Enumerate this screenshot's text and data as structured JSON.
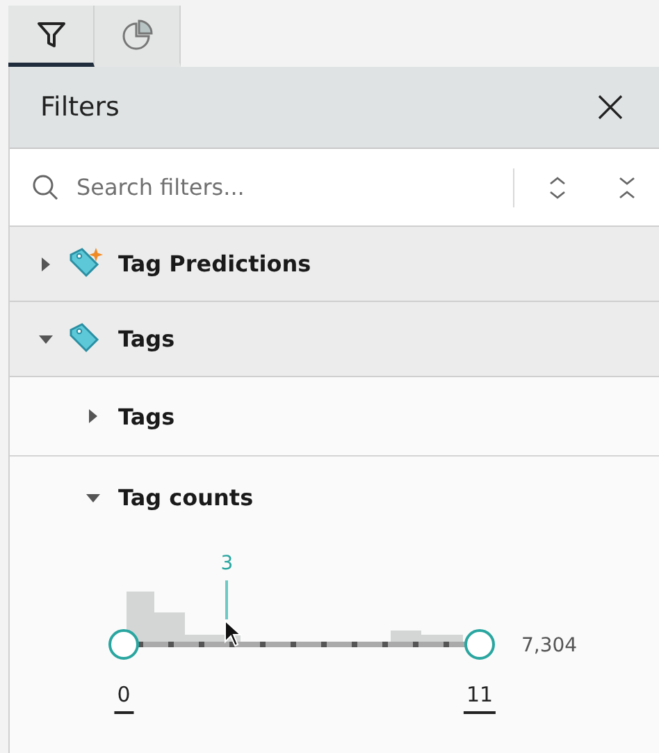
{
  "tabs": [
    {
      "kind": "filter",
      "selected": true
    },
    {
      "kind": "chart",
      "selected": false
    }
  ],
  "panel": {
    "title": "Filters",
    "search": {
      "placeholder": "Search filters..."
    }
  },
  "groups": [
    {
      "label": "Tag Predictions",
      "kind": "prediction",
      "expanded": false
    },
    {
      "label": "Tags",
      "kind": "tag",
      "expanded": true,
      "children": [
        {
          "label": "Tags",
          "expanded": false
        },
        {
          "label": "Tag counts",
          "expanded": true,
          "range": {
            "hover": {
              "label": "3",
              "level": 0.29
            },
            "total": "7,304",
            "handles": [
              {
                "label": "0",
                "level": 0
              },
              {
                "label": "11",
                "level": 1
              }
            ]
          }
        }
      ]
    }
  ]
}
